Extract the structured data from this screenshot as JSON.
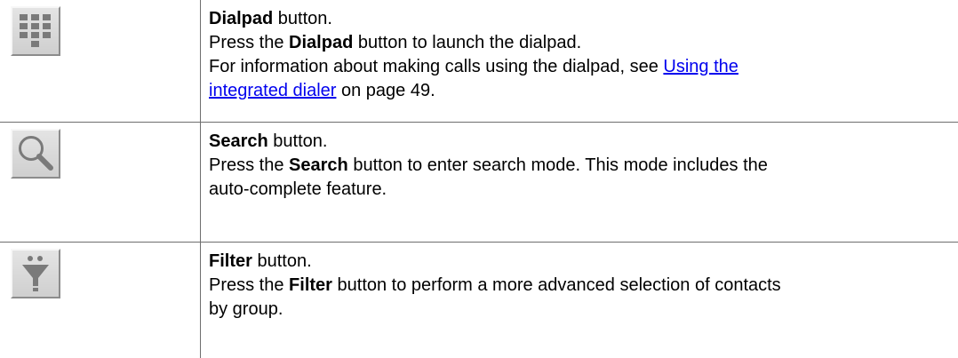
{
  "rows": [
    {
      "icon": "dialpad-icon",
      "title_bold": "Dialpad",
      "title_rest": " button.",
      "line2_pre": "Press the ",
      "line2_bold": "Dialpad",
      "line2_post": " button to launch the dialpad.",
      "line3_pre": "For information about making calls using the dialpad, see ",
      "link_part1": "Using the",
      "link_part2": "integrated dialer",
      "line4_post": " on page 49."
    },
    {
      "icon": "search-icon",
      "title_bold": "Search",
      "title_rest": " button.",
      "line2_pre": "Press the ",
      "line2_bold": "Search",
      "line2_post": " button to enter search mode. This mode includes the",
      "line3": "auto-complete feature."
    },
    {
      "icon": "filter-icon",
      "title_bold": "Filter",
      "title_rest": " button.",
      "line2_pre": "Press the ",
      "line2_bold": "Filter",
      "line2_post": " button to perform a more advanced selection of contacts",
      "line3": "by group."
    }
  ]
}
